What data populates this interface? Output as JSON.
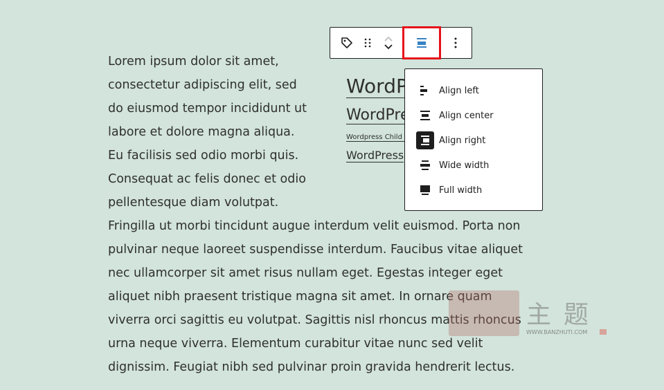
{
  "paragraph": {
    "lines": [
      "Lorem ipsum dolor sit amet,",
      "consectetur adipiscing elit, sed",
      "do eiusmod tempor incididunt ut",
      "labore et dolore magna aliqua.",
      "Eu facilisis sed odio morbi quis.",
      "Consequat ac felis donec et odio",
      "pellentesque diam volutpat.",
      "Fringilla ut morbi tincidunt augue interdum velit euismod. Porta non",
      "pulvinar neque laoreet suspendisse interdum. Faucibus vitae aliquet",
      "nec ullamcorper sit amet risus nullam eget. Egestas integer eget",
      "aliquet nibh praesent tristique magna sit amet. In ornare quam",
      "viverra orci sagittis eu volutpat. Sagittis nisl rhoncus mattis rhoncus",
      "urna neque viverra. Elementum curabitur vitae nunc sed velit",
      "dignissim. Feugiat nibh sed pulvinar proin gravida hendrerit lectus."
    ]
  },
  "block": {
    "title_large": "WordPress",
    "title_medium": "WordPress",
    "title_small": "Wordpress Child Theme",
    "title_link": "WordPress"
  },
  "toolbar": {
    "tag_icon": "tag-icon",
    "drag_icon": "drag-handle-icon",
    "mover_icon": "chevron-up-down-icon",
    "align_icon": "align-center-icon",
    "more_icon": "more-vertical-icon",
    "align_accent": "#3582c4",
    "highlight_color": "#e8101a"
  },
  "align_menu": {
    "items": [
      {
        "label": "Align left",
        "icon": "align-left-icon"
      },
      {
        "label": "Align center",
        "icon": "align-center-icon"
      },
      {
        "label": "Align right",
        "icon": "align-right-icon",
        "active": true
      },
      {
        "label": "Wide width",
        "icon": "wide-width-icon"
      },
      {
        "label": "Full width",
        "icon": "full-width-icon"
      }
    ]
  },
  "watermark": {
    "text": "主题",
    "url": "WWW.BANZHUTI.COM"
  }
}
